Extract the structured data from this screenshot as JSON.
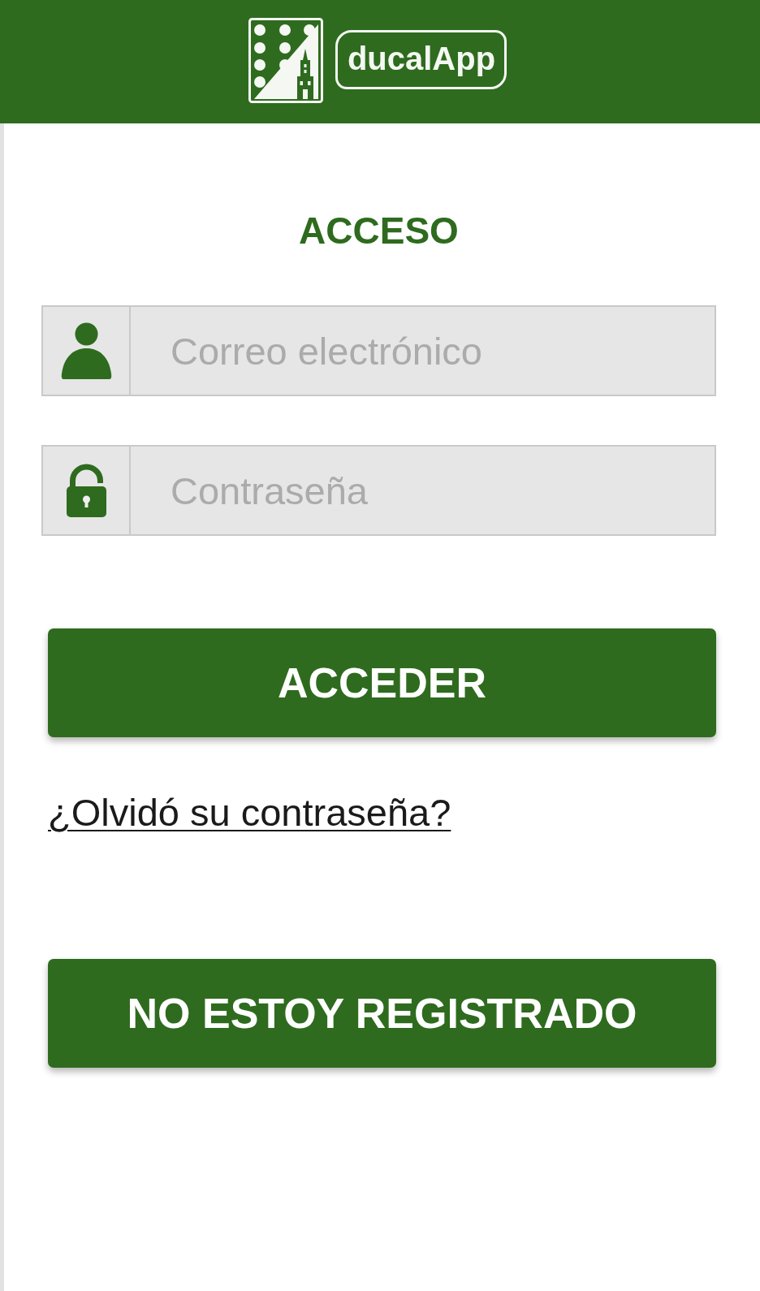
{
  "header": {
    "logo_text": "ducalApp"
  },
  "title": "ACCESO",
  "fields": [
    {
      "kind": "email",
      "placeholder": "Correo electrónico"
    },
    {
      "kind": "password",
      "placeholder": "Contraseña"
    }
  ],
  "login_button": {
    "label": "ACCEDER"
  },
  "forgot_link": {
    "label": "¿Olvidó su contraseña?"
  },
  "register_button": {
    "label": "NO ESTOY REGISTRADO"
  }
}
